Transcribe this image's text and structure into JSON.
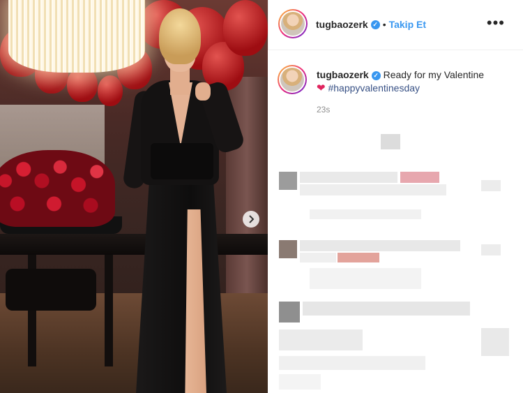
{
  "post": {
    "photo_alt": "",
    "next_icon": "chevron-right-icon"
  },
  "header": {
    "username": "tugbaozerk",
    "verified_icon": "verified-badge-icon",
    "separator": "•",
    "follow_label": "Takip Et",
    "more_label": "•••"
  },
  "caption": {
    "username": "tugbaozerk",
    "text": "Ready for my Valentine",
    "heart": "❤",
    "hashtag": "#happyvalentinesday",
    "timestamp": "23s"
  },
  "colors": {
    "accent": "#3897f0",
    "text": "#262626",
    "muted": "#8e8e8e",
    "heart": "#e0245e"
  }
}
